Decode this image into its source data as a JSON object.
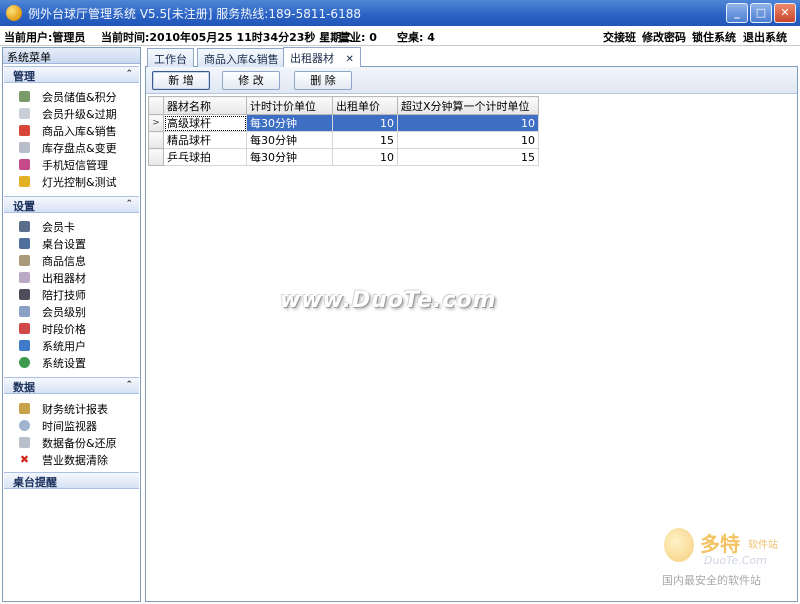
{
  "window": {
    "title": "例外台球厅管理系统 V5.5[未注册]  服务热线:189-5811-6188",
    "minimize": "_",
    "maximize": "□",
    "close": "✕"
  },
  "infobar": {
    "current_user": "当前用户:管理员",
    "current_time": "当前时间:2010年05月25 11时34分23秒 星期二",
    "business": "营业: 0",
    "free_tables": "空桌: 4",
    "menu": [
      "交接班",
      "修改密码",
      "锁住系统",
      "退出系统"
    ]
  },
  "sidebar": {
    "title": "系统菜单",
    "groups": [
      {
        "title": "管理",
        "items": [
          "会员储值&积分",
          "会员升级&过期",
          "商品入库&销售",
          "库存盘点&变更",
          "手机短信管理",
          "灯光控制&测试"
        ]
      },
      {
        "title": "设置",
        "items": [
          "会员卡",
          "桌台设置",
          "商品信息",
          "出租器材",
          "陪打技师",
          "会员级别",
          "时段价格",
          "系统用户",
          "系统设置"
        ]
      },
      {
        "title": "数据",
        "items": [
          "财务统计报表",
          "时间监视器",
          "数据备份&还原",
          "营业数据清除"
        ]
      },
      {
        "title": "桌台提醒",
        "items": []
      }
    ],
    "collapse_glyph": "⌃"
  },
  "tabs": [
    {
      "label": "工作台"
    },
    {
      "label": "商品入库&销售"
    },
    {
      "label": "出租器材",
      "close": "✕"
    }
  ],
  "toolbar": {
    "add": "新 增",
    "edit": "修 改",
    "delete": "删 除"
  },
  "grid": {
    "columns": [
      "器材名称",
      "计时计价单位",
      "出租单价",
      "超过X分钟算一个计时单位"
    ],
    "row_marker": ">",
    "rows": [
      [
        "高级球杆",
        "每30分钟",
        "10",
        "10"
      ],
      [
        "精品球杆",
        "每30分钟",
        "15",
        "10"
      ],
      [
        "乒乓球拍",
        "每30分钟",
        "10",
        "15"
      ]
    ]
  },
  "watermark": {
    "center": "www.DuoTe.com",
    "brand": "多特",
    "brand_sub": "软件站",
    "domain": "DuoTe.Com",
    "slogan": "国内最安全的软件站"
  },
  "colors": {
    "titlebar": "#2a62c4",
    "selection": "#3e6fc4",
    "border": "#7f9db9"
  }
}
